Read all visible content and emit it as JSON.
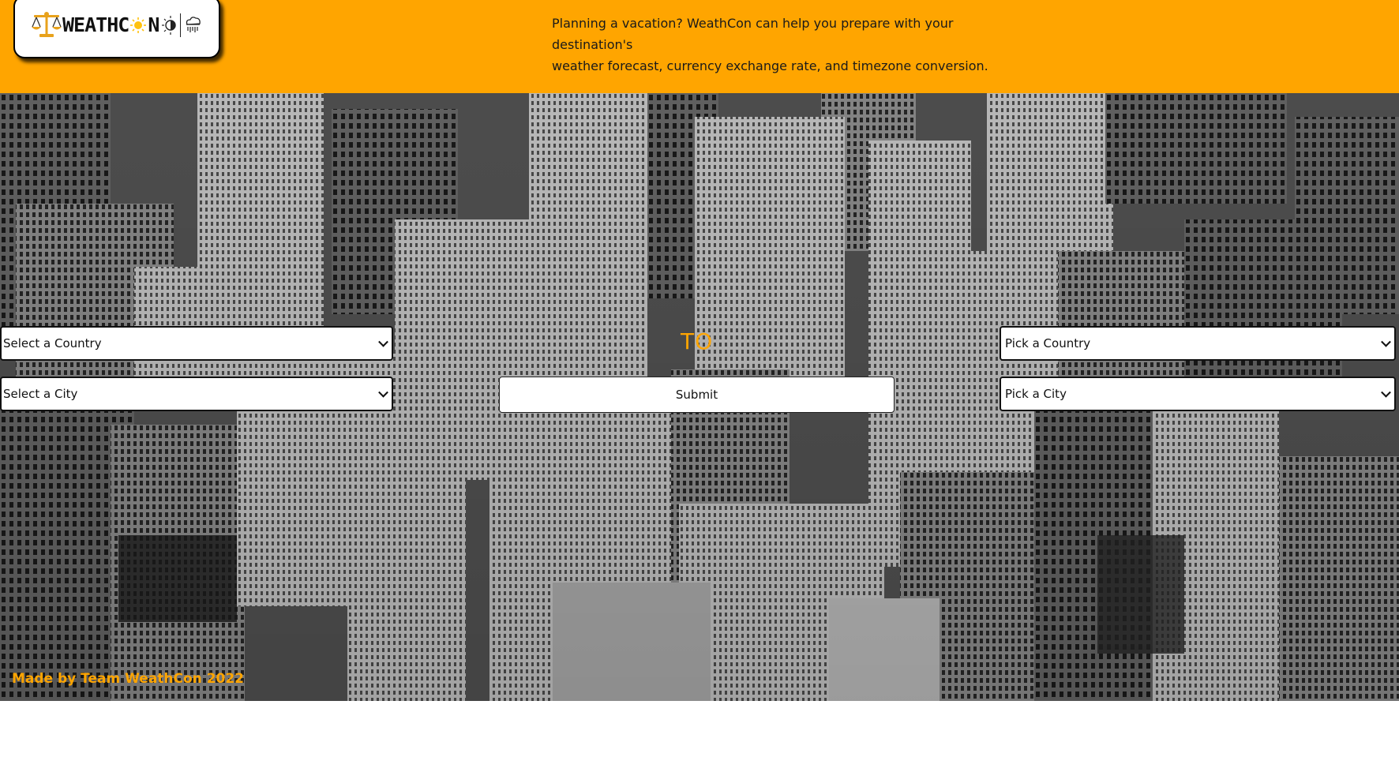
{
  "header": {
    "logo_text_before": "WEATHC",
    "logo_text_after": "N",
    "tagline_line1": "Planning a vacation? WeathCon can help you prepare with your destination's",
    "tagline_line2": "weather forecast, currency exchange rate, and timezone conversion."
  },
  "origin": {
    "country_select": "Select a Country",
    "city_select": "Select a City"
  },
  "connector": "TO",
  "destination": {
    "country_select": "Pick a Country",
    "city_select": "Pick a City"
  },
  "submit_label": "Submit",
  "footer": {
    "credit": "Made by Team WeathCon 2022"
  },
  "colors": {
    "accent": "#FFA500",
    "header_bg": "#FFA500"
  },
  "icons": [
    "scale-icon",
    "sun-icon",
    "sun-moon-icon",
    "rain-cloud-icon"
  ]
}
